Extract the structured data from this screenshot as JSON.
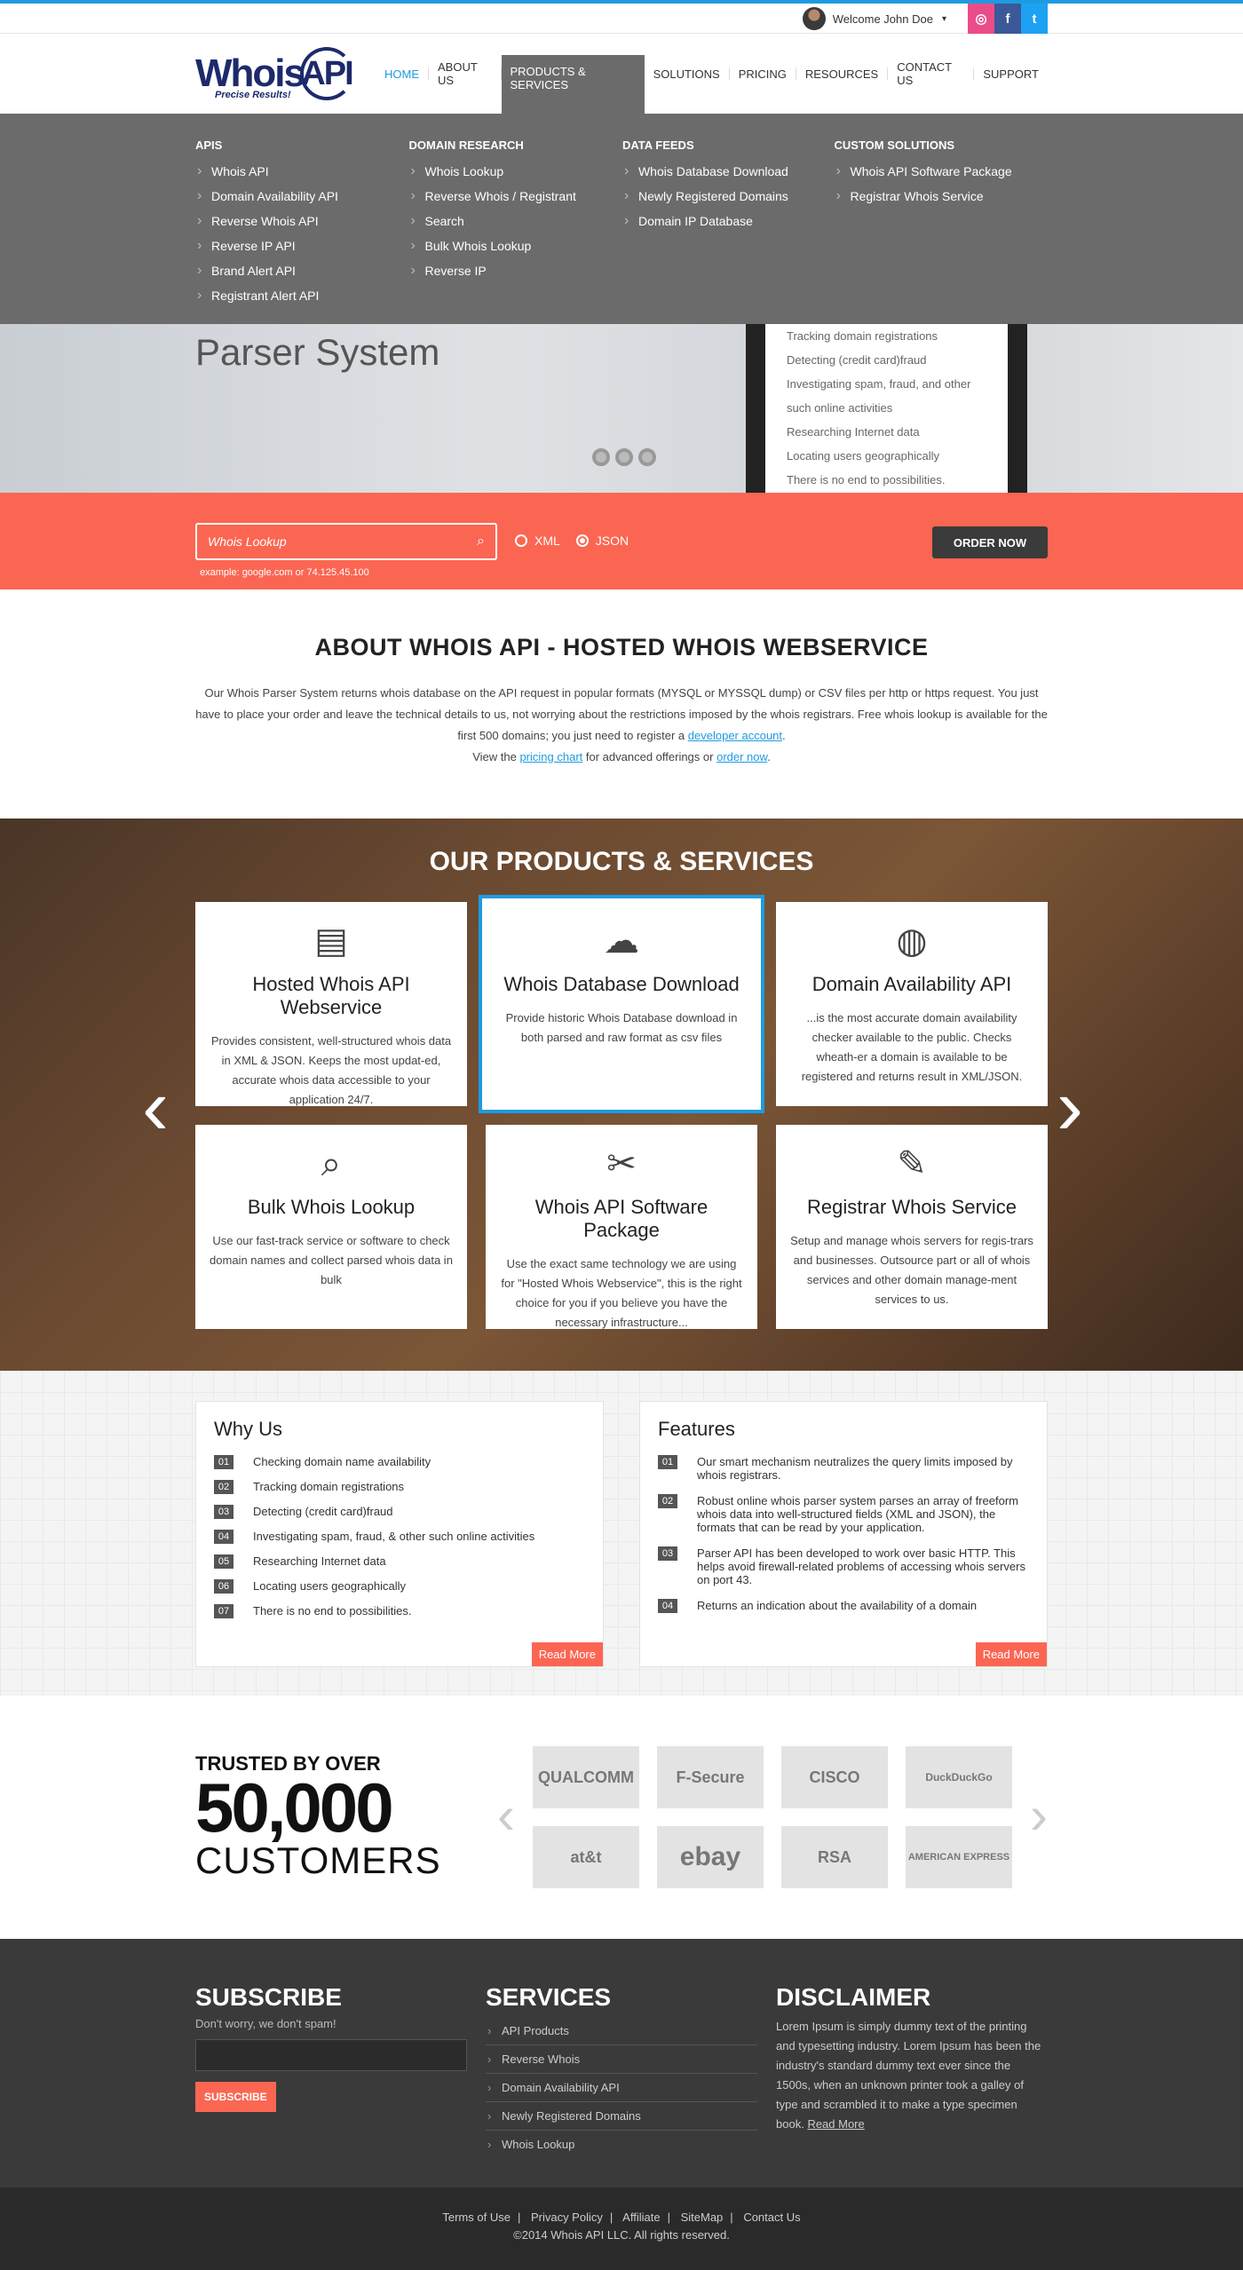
{
  "topbar": {
    "welcome": "Welcome John Doe",
    "social": [
      "dribbble-icon",
      "facebook-icon",
      "twitter-icon"
    ]
  },
  "logo": {
    "text": "Whois",
    "ring": "API",
    "tagline": "Precise Results!"
  },
  "nav": [
    {
      "label": "HOME",
      "state": "active"
    },
    {
      "label": "ABOUT US",
      "state": ""
    },
    {
      "label": "PRODUCTS & SERVICES",
      "state": "open"
    },
    {
      "label": "SOLUTIONS",
      "state": ""
    },
    {
      "label": "PRICING",
      "state": ""
    },
    {
      "label": "RESOURCES",
      "state": ""
    },
    {
      "label": "CONTACT US",
      "state": ""
    },
    {
      "label": "SUPPORT",
      "state": ""
    }
  ],
  "mega": [
    {
      "title": "APIs",
      "items": [
        "Whois API",
        "Domain Availability API",
        "Reverse Whois API",
        "Reverse IP API",
        "Brand Alert API",
        "Registrant Alert API"
      ]
    },
    {
      "title": "DOMAIN RESEARCH",
      "items": [
        "Whois Lookup",
        "Reverse Whois / Registrant",
        "Search",
        "Bulk Whois Lookup",
        "Reverse IP"
      ]
    },
    {
      "title": "DATA FEEDS",
      "items": [
        "Whois Database Download",
        "Newly Registered Domains",
        "Domain IP Database"
      ]
    },
    {
      "title": "CUSTOM SOLUTIONS",
      "items": [
        "Whois API Software Package",
        "Registrar Whois Service"
      ]
    }
  ],
  "hero": {
    "title": "Parser System",
    "screen_items": [
      "Tracking domain registrations",
      "Detecting (credit card)fraud",
      "Investigating spam, fraud, and other",
      "such online activities",
      "Researching Internet data",
      "Locating users geographically",
      "There is no end to possibilities."
    ]
  },
  "search": {
    "placeholder": "Whois Lookup",
    "example": "example: google.com or 74.125.45.100",
    "xml": "XML",
    "json": "JSON",
    "order": "ORDER NOW"
  },
  "about": {
    "title": "ABOUT WHOIS API - HOSTED WHOIS WEBSERVICE",
    "p1": "Our Whois Parser System returns whois database on the API request in popular formats (MYSQL or MYSSQL dump) or CSV files per http or https request. You just have to place your order and leave the technical details to us, not worrying about the restrictions imposed by the whois registrars. Free whois lookup is available for the first 500 domains; you just need to register a",
    "link1": "developer account",
    "p2": "View the",
    "link2": "pricing chart",
    "p3": "for advanced offerings or",
    "link3": "order now"
  },
  "products": {
    "title": "OUR PRODUCTS & SERVICES",
    "cards": [
      {
        "icon": "server-icon",
        "glyph": "▤",
        "title": "Hosted Whois API Webservice",
        "text": "Provides consistent, well-structured whois data in XML & JSON. Keeps the most updat-ed, accurate whois data accessible to your application 24/7."
      },
      {
        "icon": "cloud-download-icon",
        "glyph": "☁",
        "title": "Whois Database Download",
        "text": "Provide historic Whois Database download in both parsed and raw format as csv files"
      },
      {
        "icon": "globe-cursor-icon",
        "glyph": "◍",
        "title": "Domain Availability API",
        "text": "...is the most accurate domain availability checker available to the public. Checks wheath-er a domain is available to be registered and returns result in XML/JSON."
      },
      {
        "icon": "globe-search-icon",
        "glyph": "⌕",
        "title": "Bulk Whois Lookup",
        "text": "Use our fast-track service or software to check domain names and collect parsed whois data in bulk"
      },
      {
        "icon": "tools-icon",
        "glyph": "✂",
        "title": "Whois API Software Package",
        "text": "Use the exact same technology we are using for \"Hosted Whois Webservice\", this is the right choice for you if you believe you have the necessary infrastructure..."
      },
      {
        "icon": "edit-document-icon",
        "glyph": "✎",
        "title": "Registrar Whois Service",
        "text": "Setup and manage whois servers for regis-trars and businesses. Outsource part or all of whois services and other domain manage-ment services to us."
      }
    ]
  },
  "why": {
    "title": "Why Us",
    "items": [
      {
        "n": "01",
        "t": "Checking domain name availability"
      },
      {
        "n": "02",
        "t": "Tracking domain registrations"
      },
      {
        "n": "03",
        "t": "Detecting (credit card)fraud"
      },
      {
        "n": "04",
        "t": "Investigating spam, fraud, & other such online activities"
      },
      {
        "n": "05",
        "t": "Researching Internet data"
      },
      {
        "n": "06",
        "t": "Locating users geographically"
      },
      {
        "n": "07",
        "t": "There is no end to possibilities."
      }
    ],
    "more": "Read More"
  },
  "features": {
    "title": "Features",
    "items": [
      {
        "n": "01",
        "t": "Our smart mechanism neutralizes the query limits imposed by whois registrars."
      },
      {
        "n": "02",
        "t": "Robust online whois parser system parses an array of freeform whois data into well-structured fields (XML and JSON), the formats that can be read by your application."
      },
      {
        "n": "03",
        "t": "Parser API has been developed to work over basic HTTP. This helps avoid firewall-related problems of accessing whois servers on port 43."
      },
      {
        "n": "04",
        "t": "Returns an indication about the availability of a domain"
      }
    ],
    "more": "Read More"
  },
  "trusted": {
    "line1": "TRUSTED BY OVER",
    "line2": "50,000",
    "line3": "CUSTOMERS",
    "logos": [
      "QUALCOMM",
      "F-Secure",
      "CISCO",
      "DuckDuckGo",
      "at&t",
      "ebay",
      "RSA",
      "AMERICAN EXPRESS"
    ]
  },
  "footer": {
    "subscribe": {
      "title": "SUBSCRIBE",
      "sub": "Don't worry, we don't spam!",
      "btn": "SUBSCRIBE"
    },
    "services": {
      "title": "SERVICES",
      "items": [
        "API Products",
        "Reverse Whois",
        "Domain Availability API",
        "Newly Registered Domains",
        "Whois Lookup"
      ]
    },
    "disclaimer": {
      "title": "DISCLAIMER",
      "text": "Lorem Ipsum is simply dummy text of the printing and typesetting industry. Lorem Ipsum has been the industry's standard dummy text ever since the 1500s, when an unknown printer took a galley of type and scrambled it to make a type specimen book.",
      "more": "Read More"
    }
  },
  "bottom": {
    "links": [
      "Terms of Use",
      "Privacy Policy",
      "Affiliate",
      "SiteMap",
      "Contact Us"
    ],
    "copyright": "©2014  Whois API LLC. All rights reserved."
  }
}
